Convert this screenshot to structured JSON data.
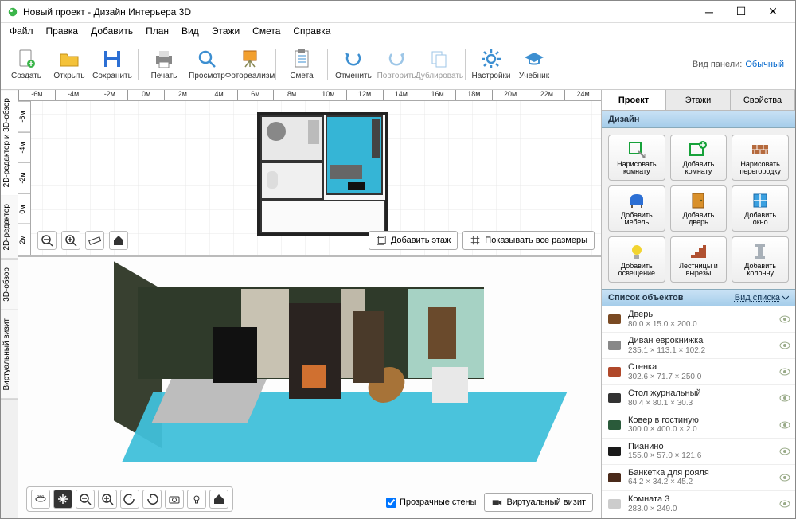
{
  "window": {
    "title": "Новый проект - Дизайн Интерьера 3D"
  },
  "menubar": [
    "Файл",
    "Правка",
    "Добавить",
    "План",
    "Вид",
    "Этажи",
    "Смета",
    "Справка"
  ],
  "toolbar": [
    {
      "id": "create",
      "label": "Создать",
      "icon": "file"
    },
    {
      "id": "open",
      "label": "Открыть",
      "icon": "folder"
    },
    {
      "id": "save",
      "label": "Сохранить",
      "icon": "floppy"
    },
    {
      "sep": true
    },
    {
      "id": "print",
      "label": "Печать",
      "icon": "printer"
    },
    {
      "id": "preview",
      "label": "Просмотр",
      "icon": "magnifier"
    },
    {
      "id": "photoreal",
      "label": "Фотореализм",
      "icon": "easel"
    },
    {
      "sep": true
    },
    {
      "id": "estimate",
      "label": "Смета",
      "icon": "clipboard"
    },
    {
      "sep": true
    },
    {
      "id": "undo",
      "label": "Отменить",
      "icon": "undo"
    },
    {
      "id": "redo",
      "label": "Повторить",
      "icon": "redo",
      "disabled": true
    },
    {
      "id": "duplicate",
      "label": "Дублировать",
      "icon": "copy",
      "disabled": true
    },
    {
      "sep": true
    },
    {
      "id": "settings",
      "label": "Настройки",
      "icon": "gear"
    },
    {
      "id": "tutorial",
      "label": "Учебник",
      "icon": "cap"
    }
  ],
  "panel_label": {
    "text": "Вид панели:",
    "link": "Обычный"
  },
  "left_tabs": [
    "2D-редактор и 3D-обзор",
    "2D-редактор",
    "3D-обзор",
    "Виртуальный визит"
  ],
  "ruler_h": [
    "-6м",
    "-4м",
    "-2м",
    "0м",
    "2м",
    "4м",
    "6м",
    "8м",
    "10м",
    "12м",
    "14м",
    "16м",
    "18м",
    "20м",
    "22м",
    "24м"
  ],
  "ruler_v": [
    "-6м",
    "-4м",
    "-2м",
    "0м",
    "2м"
  ],
  "top_buttons": {
    "add_floor": "Добавить этаж",
    "show_dims": "Показывать все размеры"
  },
  "bottom_bar": {
    "transparent": "Прозрачные стены",
    "virtual": "Виртуальный визит"
  },
  "r_tabs": [
    "Проект",
    "Этажи",
    "Свойства"
  ],
  "section_design": "Дизайн",
  "tools": [
    {
      "id": "draw-room",
      "label": "Нарисовать\nкомнату",
      "color": "#17a23a"
    },
    {
      "id": "add-room",
      "label": "Добавить\nкомнату",
      "color": "#17a23a"
    },
    {
      "id": "draw-wall",
      "label": "Нарисовать\nперегородку",
      "color": "#b56a3d"
    },
    {
      "id": "add-furniture",
      "label": "Добавить\nмебель",
      "color": "#2c6fd4"
    },
    {
      "id": "add-door",
      "label": "Добавить\nдверь",
      "color": "#d9902b"
    },
    {
      "id": "add-window",
      "label": "Добавить\nокно",
      "color": "#3aa0e0"
    },
    {
      "id": "add-light",
      "label": "Добавить\nосвещение",
      "color": "#f2d430"
    },
    {
      "id": "stairs",
      "label": "Лестницы и\nвырезы",
      "color": "#b05030"
    },
    {
      "id": "add-column",
      "label": "Добавить\nколонну",
      "color": "#a8b0b8"
    }
  ],
  "list_header": {
    "title": "Список объектов",
    "link": "Вид списка"
  },
  "objects": [
    {
      "name": "Дверь",
      "dim": "80.0 × 15.0 × 200.0",
      "icon": "door",
      "color": "#7a4a23"
    },
    {
      "name": "Диван еврокнижка",
      "dim": "235.1 × 113.1 × 102.2",
      "icon": "sofa",
      "color": "#888"
    },
    {
      "name": "Стенка",
      "dim": "302.6 × 71.7 × 250.0",
      "icon": "shelf",
      "color": "#b0482a"
    },
    {
      "name": "Стол журнальный",
      "dim": "80.4 × 80.1 × 30.3",
      "icon": "table",
      "color": "#333"
    },
    {
      "name": "Ковер в гостиную",
      "dim": "300.0 × 400.0 × 2.0",
      "icon": "rug",
      "color": "#2a5a3a"
    },
    {
      "name": "Пианино",
      "dim": "155.0 × 57.0 × 121.6",
      "icon": "piano",
      "color": "#1a1a1a"
    },
    {
      "name": "Банкетка для рояля",
      "dim": "64.2 × 34.2 × 45.2",
      "icon": "bench",
      "color": "#4a2a1a"
    },
    {
      "name": "Комната 3",
      "dim": "283.0 × 249.0",
      "icon": "room",
      "color": "#ccc"
    }
  ]
}
